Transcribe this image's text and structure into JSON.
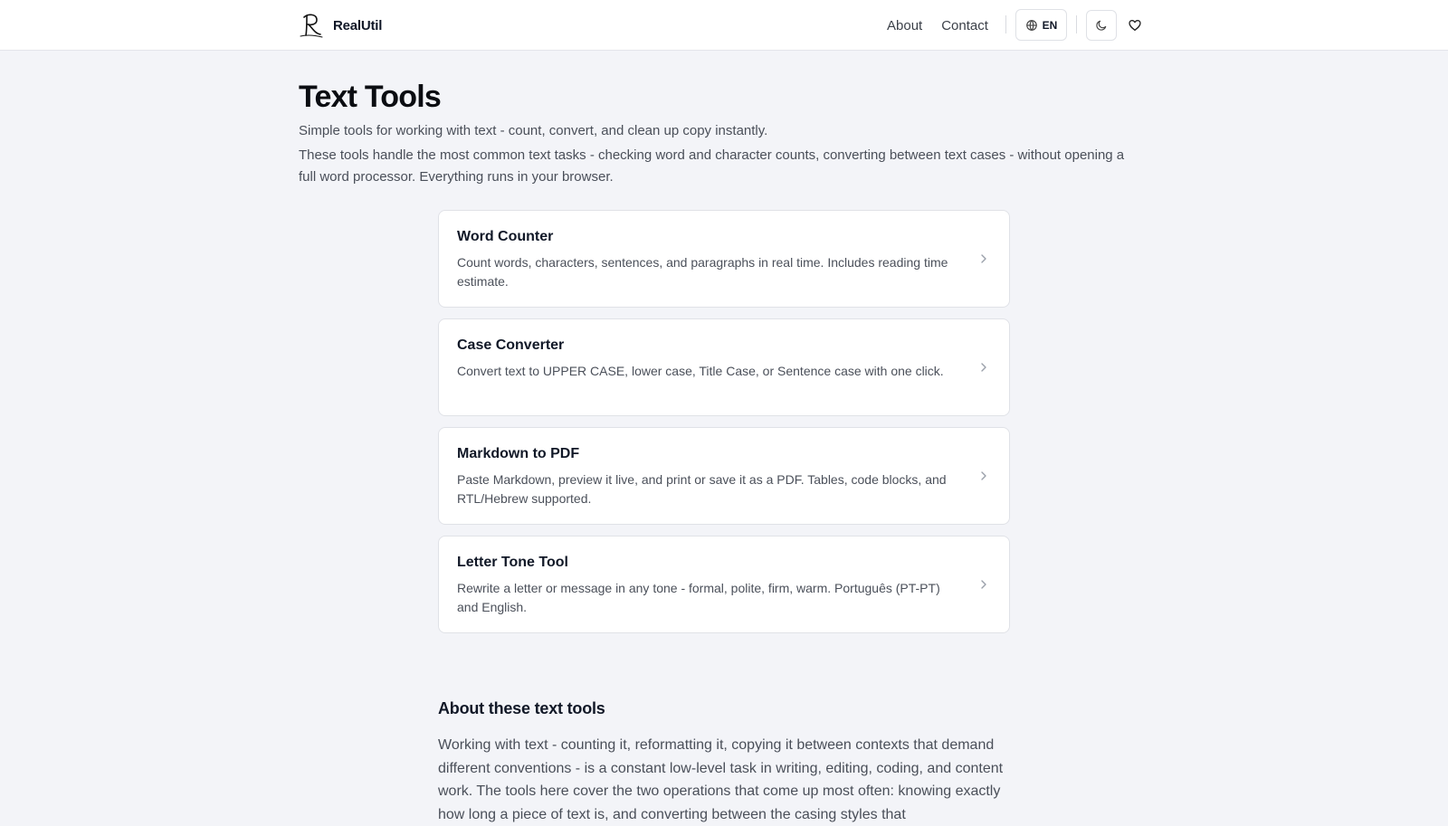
{
  "header": {
    "brand": "RealUtil",
    "nav": {
      "about": "About",
      "contact": "Contact"
    },
    "language_label": "EN",
    "icons": {
      "language": "globe-icon",
      "theme": "moon-icon",
      "favorite": "heart-icon",
      "logo": "r-logo-icon"
    }
  },
  "main": {
    "title": "Text Tools",
    "subtitle": "Simple tools for working with text - count, convert, and clean up copy instantly.",
    "description": "These tools handle the most common text tasks - checking word and character counts, converting between text cases - without opening a full word processor. Everything runs in your browser."
  },
  "tools": [
    {
      "title": "Word Counter",
      "description": "Count words, characters, sentences, and paragraphs in real time. Includes reading time estimate."
    },
    {
      "title": "Case Converter",
      "description": "Convert text to UPPER CASE, lower case, Title Case, or Sentence case with one click."
    },
    {
      "title": "Markdown to PDF",
      "description": "Paste Markdown, preview it live, and print or save it as a PDF. Tables, code blocks, and RTL/Hebrew supported."
    },
    {
      "title": "Letter Tone Tool",
      "description": "Rewrite a letter or message in any tone - formal, polite, firm, warm. Português (PT-PT) and English."
    }
  ],
  "about": {
    "heading": "About these text tools",
    "text": "Working with text - counting it, reformatting it, copying it between contexts that demand different conventions - is a constant low-level task in writing, editing, coding, and content work. The tools here cover the two operations that come up most often: knowing exactly how long a piece of text is, and converting between the casing styles that"
  },
  "colors": {
    "background": "#f3f4f8",
    "card": "#ffffff",
    "border": "#e0e2e7",
    "text": "#111827",
    "muted": "#4a4f59"
  }
}
